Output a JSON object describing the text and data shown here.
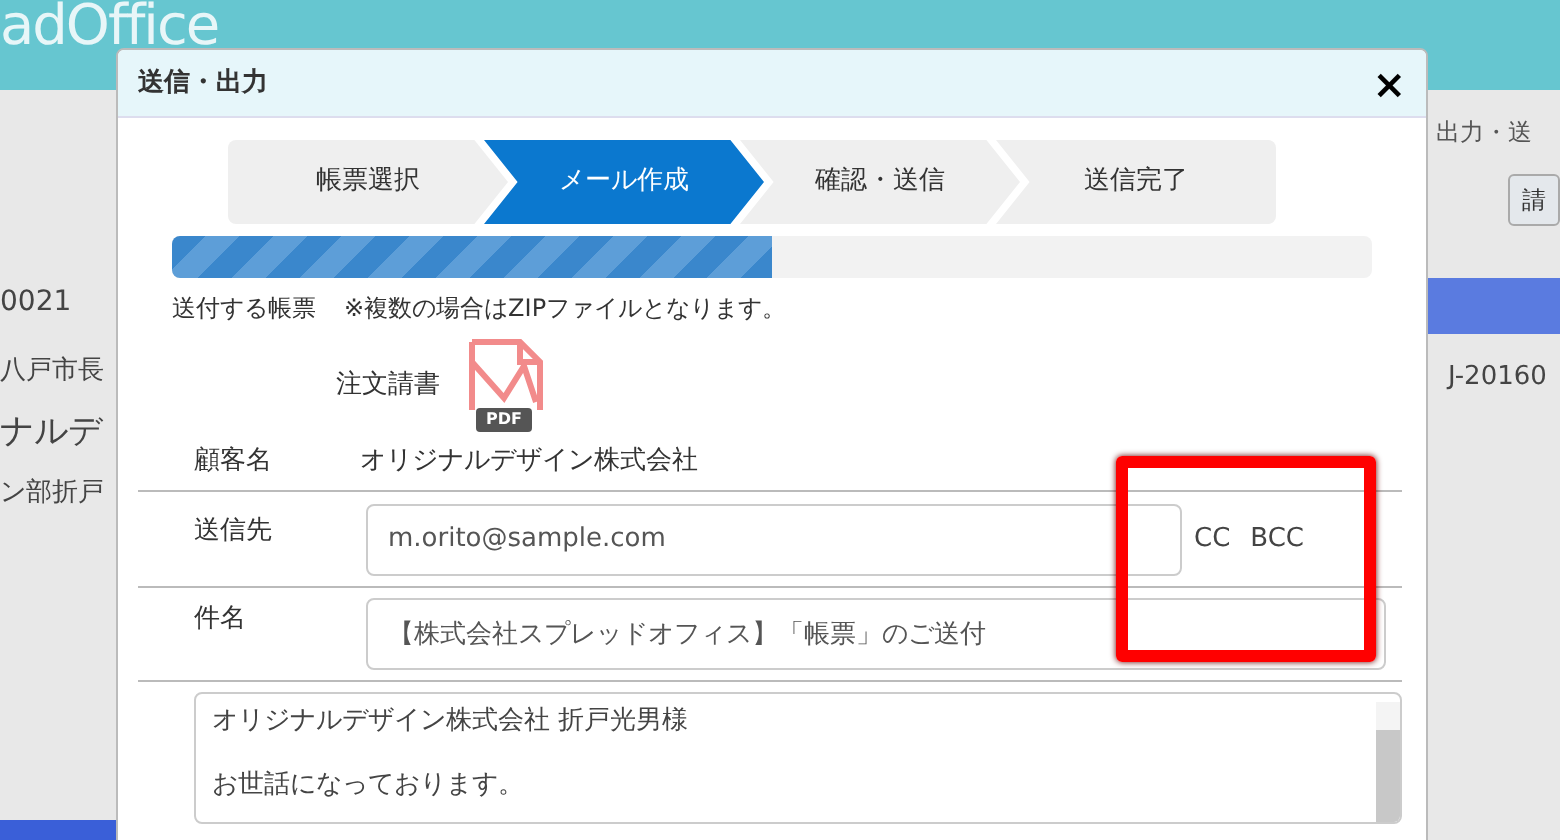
{
  "app": {
    "logo": "adOffice",
    "left_texts": [
      "0021",
      "八戸市長",
      "ナルデ",
      "ン部折戸"
    ],
    "right_toolbar_label": "出力・送",
    "right_button": "請",
    "right_cell": "J-20160"
  },
  "dialog": {
    "title": "送信・出力",
    "close": "×",
    "steps": [
      {
        "label": "帳票選択",
        "selected": false
      },
      {
        "label": "メール作成",
        "selected": true
      },
      {
        "label": "確認・送信",
        "selected": false
      },
      {
        "label": "送信完了",
        "selected": false
      }
    ],
    "progress": {
      "level": 0.5
    },
    "attachment_label": "送付する帳票",
    "attachment_note": "※複数の場合はZIPファイルとなります。",
    "document": {
      "name": "注文請書",
      "badge": "PDF"
    },
    "customer": {
      "label": "顧客名",
      "value": "オリジナルデザイン株式会社"
    },
    "to": {
      "label": "送信先",
      "value": "m.orito@sample.com",
      "cc": "CC",
      "bcc": "BCC"
    },
    "subject": {
      "label": "件名",
      "value": "【株式会社スプレッドオフィス】「帳票」のご送付"
    },
    "body": {
      "lines": [
        "オリジナルデザイン株式会社 折戸光男様",
        "お世話になっております。"
      ]
    }
  }
}
